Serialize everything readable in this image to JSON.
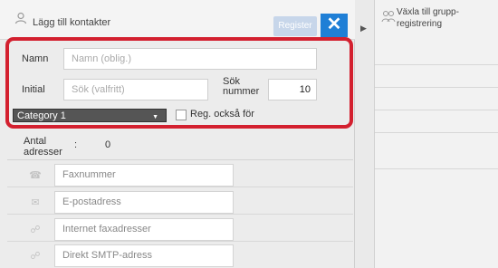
{
  "header": {
    "title": "Lägg till kontakter",
    "register_label": "Register",
    "close_symbol": "✕"
  },
  "right_panel": {
    "group_label": "Växla till grupp-registrering",
    "collapse_symbol": "▶"
  },
  "form": {
    "name_label": "Namn",
    "name_placeholder": "Namn (oblig.)",
    "initial_label": "Initial",
    "initial_placeholder": "Sök (valfritt)",
    "search_number_label": "Sök nummer",
    "search_number_value": "10",
    "category_value": "Category 1",
    "also_register_label": "Reg. också för"
  },
  "addresses": {
    "count_label": "Antal adresser",
    "count_separator": ":",
    "count_value": "0",
    "entries": [
      {
        "icon": "phone-icon",
        "glyph": "☎",
        "label": "Faxnummer"
      },
      {
        "icon": "email-icon",
        "glyph": "✉",
        "label": "E-postadress"
      },
      {
        "icon": "internet-fax-icon",
        "glyph": "☍",
        "label": "Internet faxadresser"
      },
      {
        "icon": "smtp-icon",
        "glyph": "☍",
        "label": "Direkt SMTP-adress"
      }
    ]
  },
  "colors": {
    "highlight": "#d3202f",
    "accent": "#1f7fd6"
  }
}
